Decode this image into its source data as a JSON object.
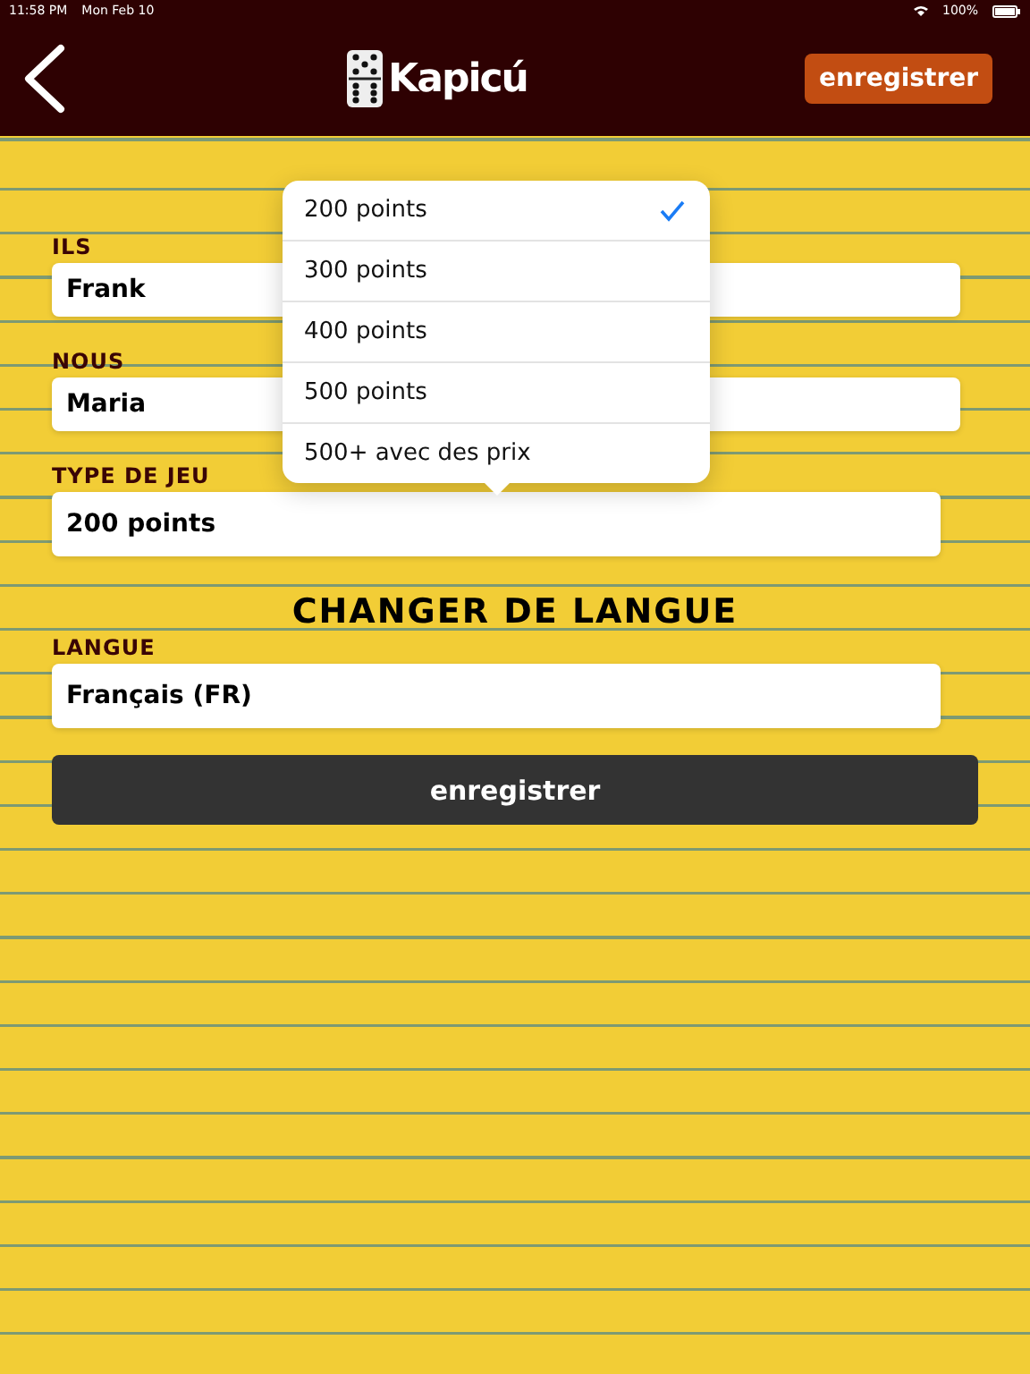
{
  "status_bar": {
    "time": "11:58 PM",
    "date": "Mon Feb 10",
    "battery": "100%"
  },
  "header": {
    "logo": "Kapicú",
    "save_button": "enregistrer"
  },
  "fields": [
    {
      "label": "ILS",
      "value": "Frank",
      "kind": "text"
    },
    {
      "label": "NOUS",
      "value": "Maria",
      "kind": "text"
    },
    {
      "label": "TYPE DE JEU",
      "value": "200 points",
      "kind": "select"
    }
  ],
  "language_section": {
    "title": "CHANGER DE LANGUE",
    "label": "LANGUE",
    "value": "Français (FR)"
  },
  "save_button": "enregistrer",
  "popover": {
    "options": [
      {
        "label": "200 points",
        "selected": true
      },
      {
        "label": "300 points",
        "selected": false
      },
      {
        "label": "400 points",
        "selected": false
      },
      {
        "label": "500 points",
        "selected": false
      },
      {
        "label": "500+ avec des prix",
        "selected": false
      }
    ]
  }
}
